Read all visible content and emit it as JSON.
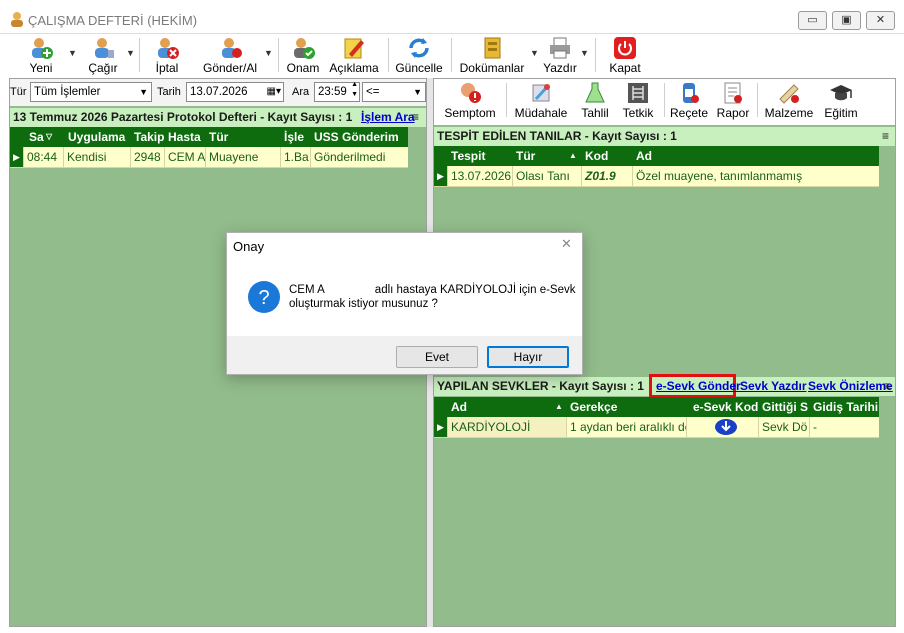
{
  "window": {
    "title": "ÇALIŞMA DEFTERİ (HEKİM)",
    "controls": {
      "minimize": "▭",
      "maximize": "▣",
      "close": "✕"
    }
  },
  "toolbar": [
    {
      "label": "Yeni",
      "icon": "user-add-icon",
      "dropdown": true
    },
    {
      "label": "Çağır",
      "icon": "call-user-icon",
      "dropdown": true
    },
    {
      "label": "İptal",
      "icon": "user-cancel-icon",
      "dropdown": false
    },
    {
      "label": "Gönder/Al",
      "icon": "user-transfer-icon",
      "dropdown": true
    },
    {
      "label": "Onam",
      "icon": "consent-icon",
      "dropdown": false
    },
    {
      "label": "Açıklama",
      "icon": "pencil-note-icon",
      "dropdown": false
    },
    {
      "label": "Güncelle",
      "icon": "refresh-icon",
      "dropdown": false
    },
    {
      "label": "Dokümanlar",
      "icon": "documents-icon",
      "dropdown": true
    },
    {
      "label": "Yazdır",
      "icon": "printer-icon",
      "dropdown": true
    },
    {
      "label": "Kapat",
      "icon": "power-icon",
      "dropdown": false
    }
  ],
  "filter": {
    "tur_label": "Tür",
    "tur_value": "Tüm İşlemler",
    "tarih_label": "Tarih",
    "tarih_value": "13.07.2026",
    "ara_label": "Ara",
    "ara_value": "23:59",
    "op_value": "<="
  },
  "protocol": {
    "header": "13 Temmuz 2026 Pazartesi Protokol Defteri - Kayıt Sayısı : 1",
    "action_link": "İşlem Ara",
    "menu_glyph": "≡",
    "columns": [
      "Sa",
      "Uygulama",
      "Takip",
      "Hasta",
      "Tür",
      "İşle",
      "USS Gönderim"
    ],
    "rows": [
      [
        "08:44",
        "Kendisi",
        "2948",
        "CEM A",
        "Muayene",
        "1.Ba",
        "Gönderilmedi"
      ]
    ]
  },
  "right_toolbar": [
    {
      "label": "Semptom",
      "icon": "symptom-icon"
    },
    {
      "label": "Müdahale",
      "icon": "intervention-icon"
    },
    {
      "label": "Tahlil",
      "icon": "lab-flask-icon"
    },
    {
      "label": "Tetkik",
      "icon": "xray-icon"
    },
    {
      "label": "Reçete",
      "icon": "prescription-icon"
    },
    {
      "label": "Rapor",
      "icon": "report-icon"
    },
    {
      "label": "Malzeme",
      "icon": "supplies-icon"
    },
    {
      "label": "Eğitim",
      "icon": "graduation-cap-icon"
    }
  ],
  "diagnoses": {
    "header": "TESPİT EDİLEN TANILAR - Kayıt Sayısı : 1",
    "menu_glyph": "≡",
    "columns": [
      "Tespit",
      "Tür",
      "Kod",
      "Ad"
    ],
    "rows": [
      [
        "13.07.2026",
        "Olası Tanı",
        "Z01.9",
        "Özel muayene, tanımlanmamış"
      ]
    ]
  },
  "referrals": {
    "header": "YAPILAN SEVKLER - Kayıt Sayısı : 1",
    "links": [
      "e-Sevk Gönder",
      "Sevk Yazdır",
      "Sevk Önizleme"
    ],
    "menu_glyph": "≡",
    "columns": [
      "Ad",
      "Gerekçe",
      "e-Sevk Kod",
      "Gittiği S",
      "Gidiş Tarihi"
    ],
    "rows": [
      [
        "KARDİYOLOJİ",
        "1 aydan beri aralıklı de",
        "",
        "Sevk Dö",
        "-"
      ]
    ]
  },
  "dialog": {
    "title": "Onay",
    "close_glyph": "✕",
    "icon": "question-icon",
    "patient": "CEM A",
    "message_line1": "adlı hastaya KARDİYOLOJİ için e-Sevk",
    "message_line2": "oluşturmak istiyor musunuz ?",
    "yes_label": "Evet",
    "no_label": "Hayır"
  },
  "colors": {
    "panel_green": "#92bc8b",
    "grid_header_green": "#0e6b0e",
    "header_bar_green": "#c8f0bf",
    "row_yellow": "#ffffcc",
    "highlight_red": "#e01010",
    "link_blue": "#0000cc"
  }
}
